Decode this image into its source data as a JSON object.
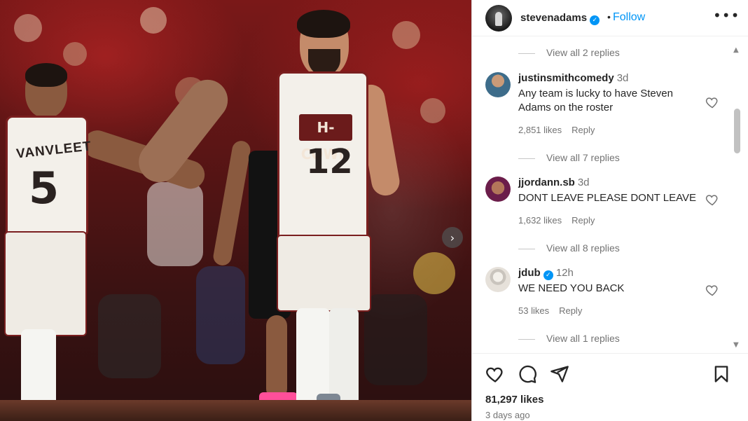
{
  "post": {
    "username": "stevenadams",
    "verified": true,
    "follow_label": "Follow",
    "separator": "•",
    "more_label": "•••",
    "likes": "81,297 likes",
    "date": "3 days ago"
  },
  "photo": {
    "left_player_name": "VANVLEET",
    "left_player_number": "5",
    "right_player_team": "H-COWN",
    "right_player_number": "12",
    "next_icon": "›"
  },
  "comments": {
    "top_view_replies": "View all 2 replies",
    "items": [
      {
        "username": "justinsmithcomedy",
        "time": "3d",
        "verified": false,
        "text": "Any team is lucky to have Steven Adams on the roster",
        "likes": "2,851 likes",
        "reply": "Reply",
        "view_replies": "View all 7 replies"
      },
      {
        "username": "jjordann.sb",
        "time": "3d",
        "verified": false,
        "text": "DONT LEAVE PLEASE DONT LEAVE",
        "likes": "1,632 likes",
        "reply": "Reply",
        "view_replies": "View all 8 replies"
      },
      {
        "username": "jdub",
        "time": "12h",
        "verified": true,
        "text": "WE NEED YOU BACK",
        "likes": "53 likes",
        "reply": "Reply",
        "view_replies": "View all 1 replies"
      }
    ]
  },
  "scrollbar": {
    "up": "▲",
    "down": "▼"
  },
  "colors": {
    "accent": "#0095f6",
    "muted": "#737373",
    "text": "#262626",
    "jersey_trim": "#7a1f1f"
  },
  "icons": [
    "heart-icon",
    "comment-icon",
    "share-icon",
    "bookmark-icon",
    "more-icon",
    "verified-icon",
    "chevron-right-icon"
  ]
}
